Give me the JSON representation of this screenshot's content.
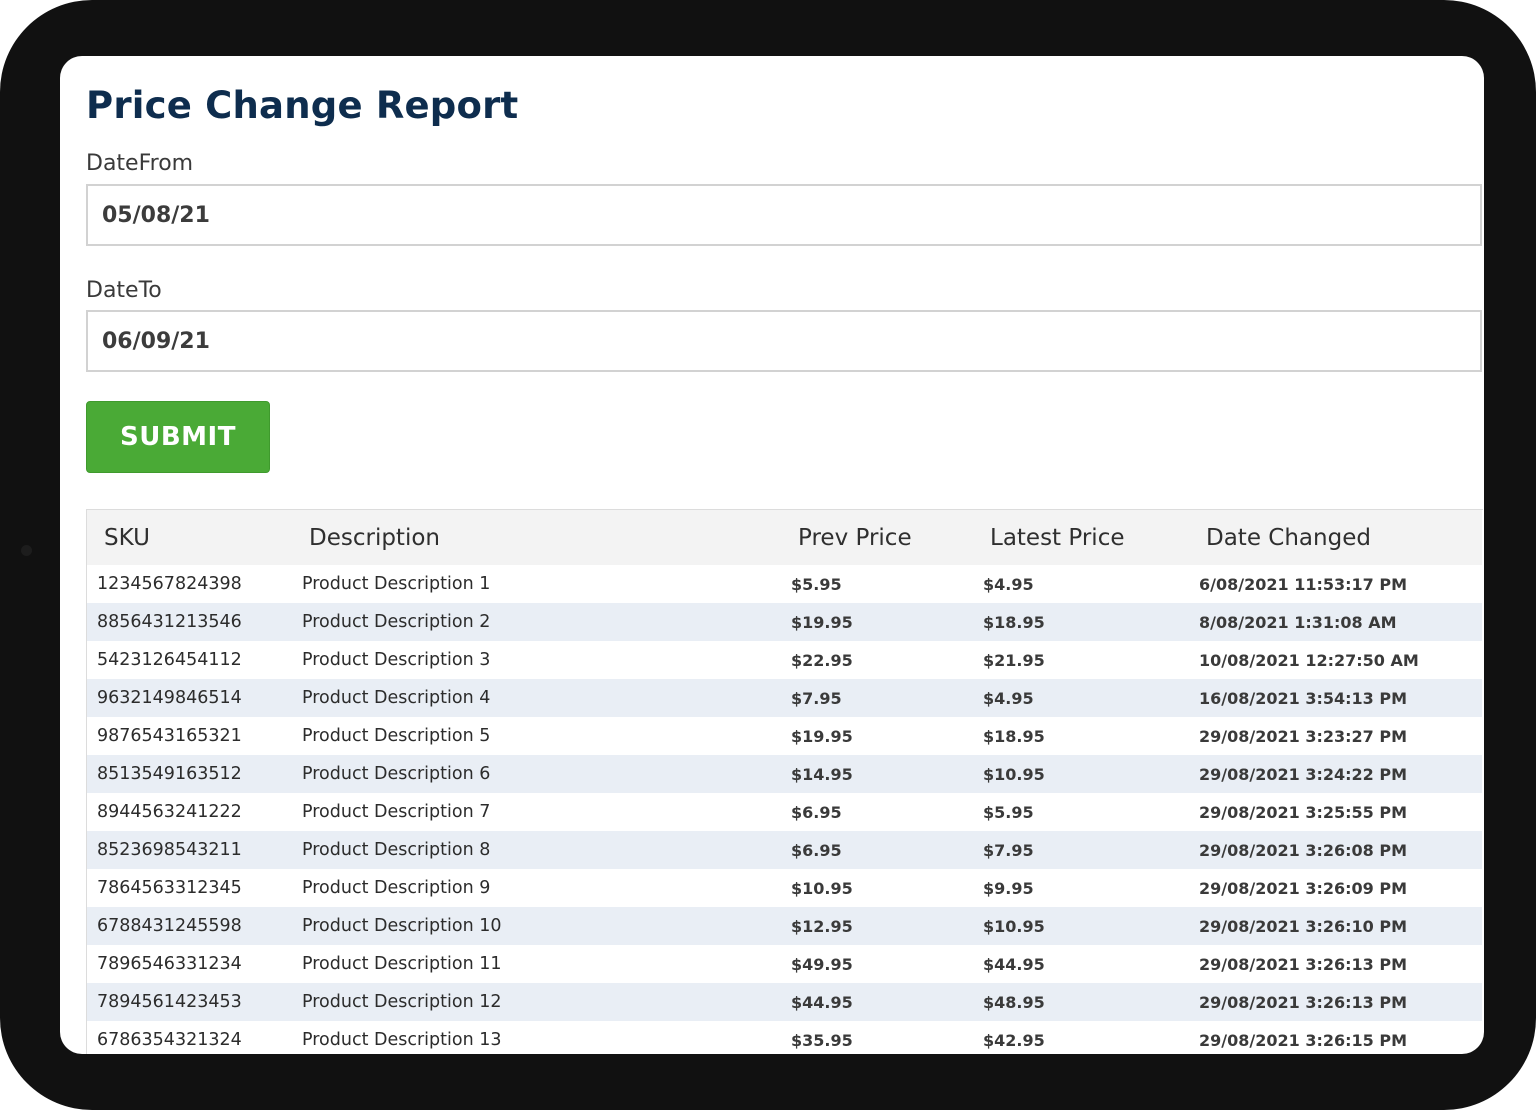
{
  "page": {
    "title": "Price Change Report"
  },
  "form": {
    "date_from_label": "DateFrom",
    "date_from_value": "05/08/21",
    "date_to_label": "DateTo",
    "date_to_value": "06/09/21",
    "submit_label": "SUBMIT"
  },
  "table": {
    "headers": [
      "SKU",
      "Description",
      "Prev Price",
      "Latest Price",
      "Date Changed"
    ],
    "rows": [
      {
        "sku": "1234567824398",
        "description": "Product Description 1",
        "prev_price": "$5.95",
        "latest_price": "$4.95",
        "date_changed": "6/08/2021 11:53:17 PM"
      },
      {
        "sku": "8856431213546",
        "description": "Product Description 2",
        "prev_price": "$19.95",
        "latest_price": "$18.95",
        "date_changed": "8/08/2021 1:31:08 AM"
      },
      {
        "sku": "5423126454112",
        "description": "Product Description 3",
        "prev_price": "$22.95",
        "latest_price": "$21.95",
        "date_changed": "10/08/2021 12:27:50 AM"
      },
      {
        "sku": "9632149846514",
        "description": "Product Description 4",
        "prev_price": "$7.95",
        "latest_price": "$4.95",
        "date_changed": "16/08/2021 3:54:13 PM"
      },
      {
        "sku": "9876543165321",
        "description": "Product Description 5",
        "prev_price": "$19.95",
        "latest_price": "$18.95",
        "date_changed": "29/08/2021 3:23:27 PM"
      },
      {
        "sku": "8513549163512",
        "description": "Product Description 6",
        "prev_price": "$14.95",
        "latest_price": "$10.95",
        "date_changed": "29/08/2021 3:24:22 PM"
      },
      {
        "sku": "8944563241222",
        "description": "Product Description 7",
        "prev_price": "$6.95",
        "latest_price": "$5.95",
        "date_changed": "29/08/2021 3:25:55 PM"
      },
      {
        "sku": "8523698543211",
        "description": "Product Description 8",
        "prev_price": "$6.95",
        "latest_price": "$7.95",
        "date_changed": "29/08/2021 3:26:08 PM"
      },
      {
        "sku": "7864563312345",
        "description": "Product Description 9",
        "prev_price": "$10.95",
        "latest_price": "$9.95",
        "date_changed": "29/08/2021 3:26:09 PM"
      },
      {
        "sku": "6788431245598",
        "description": "Product Description 10",
        "prev_price": "$12.95",
        "latest_price": "$10.95",
        "date_changed": "29/08/2021 3:26:10 PM"
      },
      {
        "sku": "7896546331234",
        "description": "Product Description 11",
        "prev_price": "$49.95",
        "latest_price": "$44.95",
        "date_changed": "29/08/2021 3:26:13 PM"
      },
      {
        "sku": "7894561423453",
        "description": "Product Description 12",
        "prev_price": "$44.95",
        "latest_price": "$48.95",
        "date_changed": "29/08/2021 3:26:13 PM"
      },
      {
        "sku": "6786354321324",
        "description": "Product Description 13",
        "prev_price": "$35.95",
        "latest_price": "$42.95",
        "date_changed": "29/08/2021 3:26:15 PM"
      }
    ]
  },
  "colors": {
    "title": "#0e2d4e",
    "submit_button": "#4aaa36",
    "row_stripe": "#e9eef5",
    "header_bg": "#f3f3f3",
    "device_frame": "#111111"
  }
}
